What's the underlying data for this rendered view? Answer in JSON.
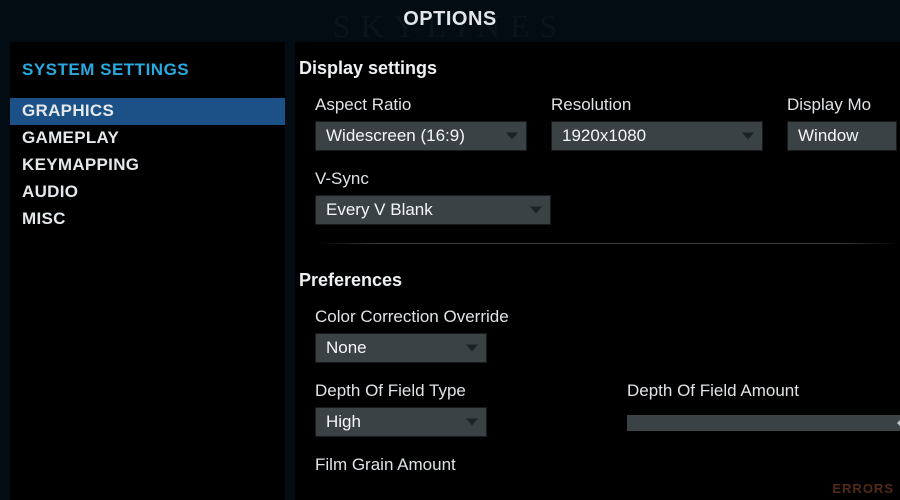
{
  "header": {
    "title": "OPTIONS",
    "watermark": "SKYLINES"
  },
  "sidebar": {
    "title": "SYSTEM SETTINGS",
    "items": [
      {
        "label": "GRAPHICS",
        "selected": true
      },
      {
        "label": "GAMEPLAY",
        "selected": false
      },
      {
        "label": "KEYMAPPING",
        "selected": false
      },
      {
        "label": "AUDIO",
        "selected": false
      },
      {
        "label": "MISC",
        "selected": false
      }
    ]
  },
  "content": {
    "display_section": {
      "heading": "Display settings",
      "aspect_ratio": {
        "label": "Aspect Ratio",
        "value": "Widescreen (16:9)"
      },
      "resolution": {
        "label": "Resolution",
        "value": "1920x1080"
      },
      "display_mode": {
        "label": "Display Mo",
        "value": "Window"
      },
      "vsync": {
        "label": "V-Sync",
        "value": "Every V Blank"
      }
    },
    "preferences_section": {
      "heading": "Preferences",
      "color_correction": {
        "label": "Color Correction Override",
        "value": "None"
      },
      "dof_type": {
        "label": "Depth Of Field Type",
        "value": "High"
      },
      "dof_amount": {
        "label": "Depth Of Field Amount",
        "value": 1.0
      },
      "film_grain": {
        "label": "Film Grain Amount"
      }
    }
  },
  "footer": {
    "errors_watermark": "ERRORS"
  }
}
